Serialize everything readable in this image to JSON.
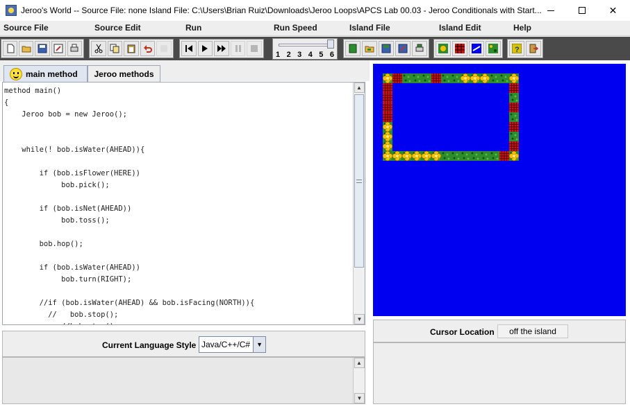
{
  "window": {
    "title": "Jeroo's World -- Source File: none    Island File: C:\\Users\\Brian Ruiz\\Downloads\\Jeroo Loops\\APCS Lab 00.03 - Jeroo Conditionals with Start...",
    "icon": "jeroo-app-icon"
  },
  "menu": {
    "items": [
      "Source File",
      "Source Edit",
      "Run",
      "Run Speed",
      "Island File",
      "Island Edit",
      "Help"
    ]
  },
  "toolbar": {
    "file_icons": [
      "new-file-icon",
      "open-file-icon",
      "save-icon",
      "save-as-icon",
      "print-icon"
    ],
    "edit_icons": [
      "cut-icon",
      "copy-icon",
      "paste-icon",
      "undo-icon",
      "redo-icon"
    ],
    "run_icons": [
      "reset-icon",
      "step-icon",
      "run-icon",
      "pause-icon",
      "stop-icon"
    ],
    "speed_labels": [
      "1",
      "2",
      "3",
      "4",
      "5",
      "6"
    ],
    "speed_value": 6,
    "island_file_icons": [
      "new-island-icon",
      "open-island-icon",
      "save-island-icon",
      "save-island-as-icon",
      "print-island-icon"
    ],
    "island_edit_icons": [
      "flower-tool-icon",
      "net-tool-icon",
      "water-tool-icon",
      "land-tool-icon"
    ],
    "help_icons": [
      "help-icon",
      "exit-icon"
    ]
  },
  "tabs": {
    "main": "main method",
    "jeroo": "Jeroo methods"
  },
  "editor": {
    "code": "method main()\n{\n    Jeroo bob = new Jeroo();\n\n\n    while(! bob.isWater(AHEAD)){\n\n        if (bob.isFlower(HERE))\n             bob.pick();\n\n        if (bob.isNet(AHEAD))\n             bob.toss();\n\n        bob.hop();\n\n        if (bob.isWater(AHEAD))\n             bob.turn(RIGHT);\n\n        //if (bob.isWater(AHEAD) && bob.isFacing(NORTH)){\n          //   bob.stop();\n             //bob.stop();"
  },
  "language": {
    "label": "Current Language Style",
    "value": "Java/C++/C#"
  },
  "cursor": {
    "label": "Cursor Location",
    "value": "off the island"
  },
  "colors": {
    "water": "#0000f0",
    "grass": "#2e8b2e",
    "net": "#c81414",
    "flower": "#f5c400"
  }
}
